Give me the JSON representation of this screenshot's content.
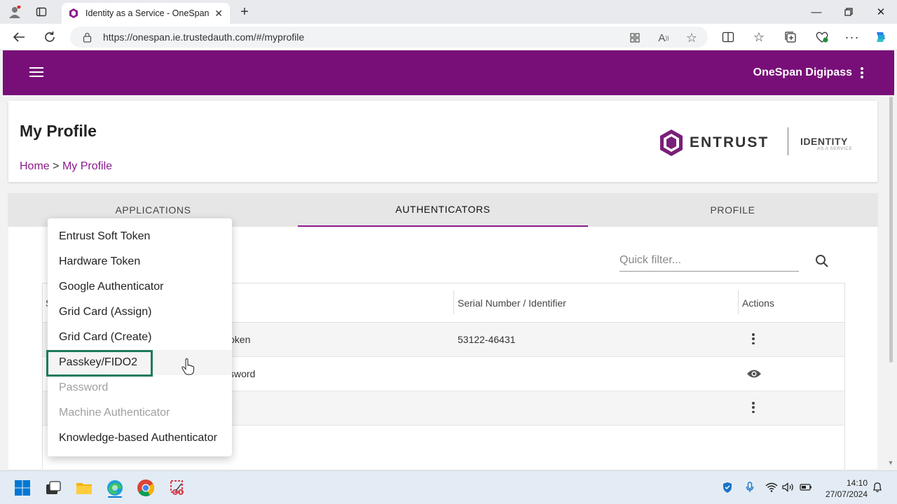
{
  "browser": {
    "tab_title": "Identity as a Service - OneSpan",
    "url": "https://onespan.ie.trustedauth.com/#/myprofile"
  },
  "header": {
    "app_name": "OneSpan Digipass"
  },
  "page": {
    "title": "My Profile",
    "breadcrumb_home": "Home",
    "breadcrumb_sep": ">",
    "breadcrumb_current": "My Profile"
  },
  "logo": {
    "brand": "ENTRUST",
    "product": "IDENTITY",
    "tagline": "AS A SERVICE"
  },
  "tabs": [
    {
      "label": "APPLICATIONS",
      "active": false
    },
    {
      "label": "AUTHENTICATORS",
      "active": true
    },
    {
      "label": "PROFILE",
      "active": false
    }
  ],
  "filter": {
    "placeholder": "Quick filter..."
  },
  "table": {
    "columns": {
      "first": "S",
      "serial": "Serial Number / Identifier",
      "actions": "Actions"
    },
    "rows": [
      {
        "type_fragment": "oken",
        "serial": "53122-46431",
        "action": "more-icon"
      },
      {
        "type_fragment": "sword",
        "serial": "",
        "action": "eye-icon"
      },
      {
        "type_fragment": "",
        "serial": "",
        "action": "more-icon"
      }
    ]
  },
  "menu": {
    "items": [
      {
        "label": "Entrust Soft Token",
        "disabled": false
      },
      {
        "label": "Hardware Token",
        "disabled": false
      },
      {
        "label": "Google Authenticator",
        "disabled": false
      },
      {
        "label": "Grid Card (Assign)",
        "disabled": false
      },
      {
        "label": "Grid Card (Create)",
        "disabled": false
      },
      {
        "label": "Passkey/FIDO2",
        "disabled": false,
        "hovered": true
      },
      {
        "label": "Password",
        "disabled": true
      },
      {
        "label": "Machine Authenticator",
        "disabled": true
      },
      {
        "label": "Knowledge-based Authenticator",
        "disabled": false
      }
    ]
  },
  "taskbar": {
    "time": "14:10",
    "date": "27/07/2024"
  },
  "colors": {
    "brand": "#780f78",
    "highlight": "#1e7a5a"
  }
}
